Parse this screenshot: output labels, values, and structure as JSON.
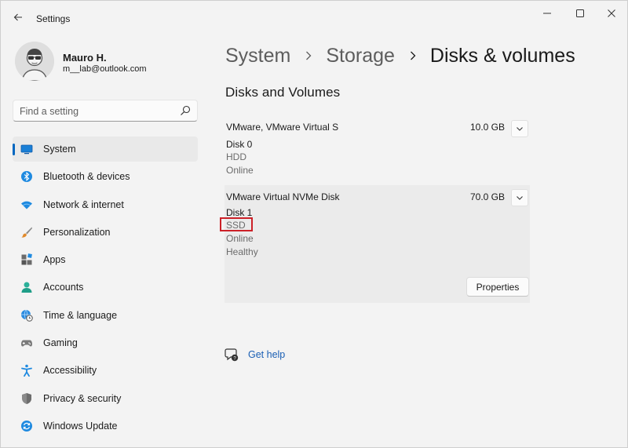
{
  "window": {
    "title": "Settings"
  },
  "profile": {
    "name": "Mauro H.",
    "email": "m__lab@outlook.com"
  },
  "search": {
    "placeholder": "Find a setting"
  },
  "nav": {
    "items": [
      {
        "label": "System",
        "icon": "monitor-icon",
        "active": true
      },
      {
        "label": "Bluetooth & devices",
        "icon": "bluetooth-icon"
      },
      {
        "label": "Network & internet",
        "icon": "wifi-icon"
      },
      {
        "label": "Personalization",
        "icon": "brush-icon"
      },
      {
        "label": "Apps",
        "icon": "apps-icon"
      },
      {
        "label": "Accounts",
        "icon": "person-icon"
      },
      {
        "label": "Time & language",
        "icon": "globe-clock-icon"
      },
      {
        "label": "Gaming",
        "icon": "gamepad-icon"
      },
      {
        "label": "Accessibility",
        "icon": "accessibility-icon"
      },
      {
        "label": "Privacy & security",
        "icon": "shield-icon"
      },
      {
        "label": "Windows Update",
        "icon": "update-icon"
      }
    ]
  },
  "breadcrumb": [
    "System",
    "Storage",
    "Disks & volumes"
  ],
  "section_title": "Disks and Volumes",
  "disks": [
    {
      "name": "VMware, VMware Virtual S",
      "size": "10.0 GB",
      "number": "Disk 0",
      "type": "HDD",
      "status": [
        "Online"
      ]
    },
    {
      "name": "VMware Virtual NVMe Disk",
      "size": "70.0 GB",
      "number": "Disk 1",
      "type": "SSD",
      "status": [
        "Online",
        "Healthy"
      ],
      "button": "Properties"
    }
  ],
  "help": {
    "label": "Get help"
  },
  "colors": {
    "accent": "#0067c0",
    "highlight": "#cc2128",
    "link": "#1a5fb4"
  }
}
